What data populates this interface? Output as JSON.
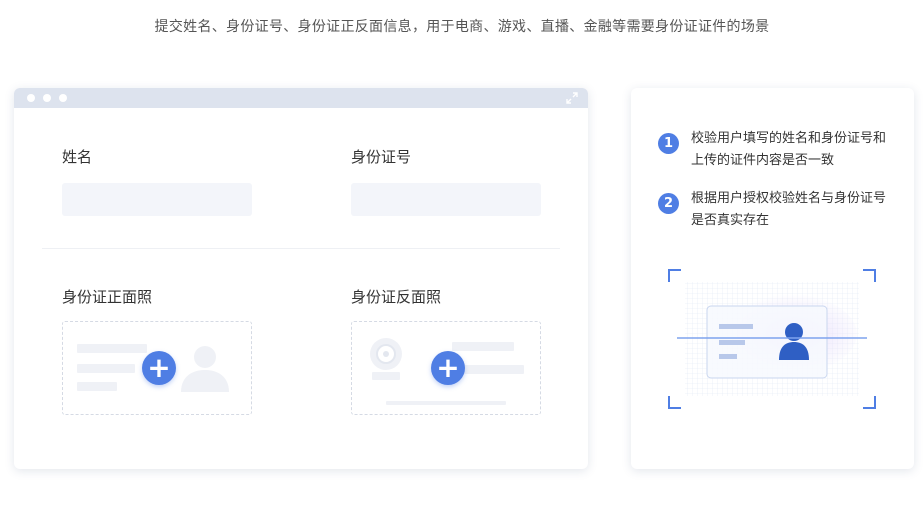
{
  "header": {
    "subtitle": "提交姓名、身份证号、身份证正反面信息，用于电商、游戏、直播、金融等需要身份证证件的场景"
  },
  "form": {
    "name_label": "姓名",
    "id_number_label": "身份证号",
    "name_value": "",
    "id_number_value": "",
    "id_front_label": "身份证正面照",
    "id_back_label": "身份证反面照"
  },
  "info": {
    "steps": [
      {
        "number": "1",
        "text": "校验用户填写的姓名和身份证号和上传的证件内容是否一致"
      },
      {
        "number": "2",
        "text": "根据用户授权校验姓名与身份证号是否真实存在"
      }
    ]
  },
  "colors": {
    "accent": "#4f7ee4",
    "titlebar": "#dde3ee",
    "field_bg": "#f3f5fa"
  },
  "icons": {
    "upload": "plus-icon",
    "avatar": "person-icon",
    "emblem": "emblem-icon",
    "scanner": "id-scan-illustration"
  }
}
